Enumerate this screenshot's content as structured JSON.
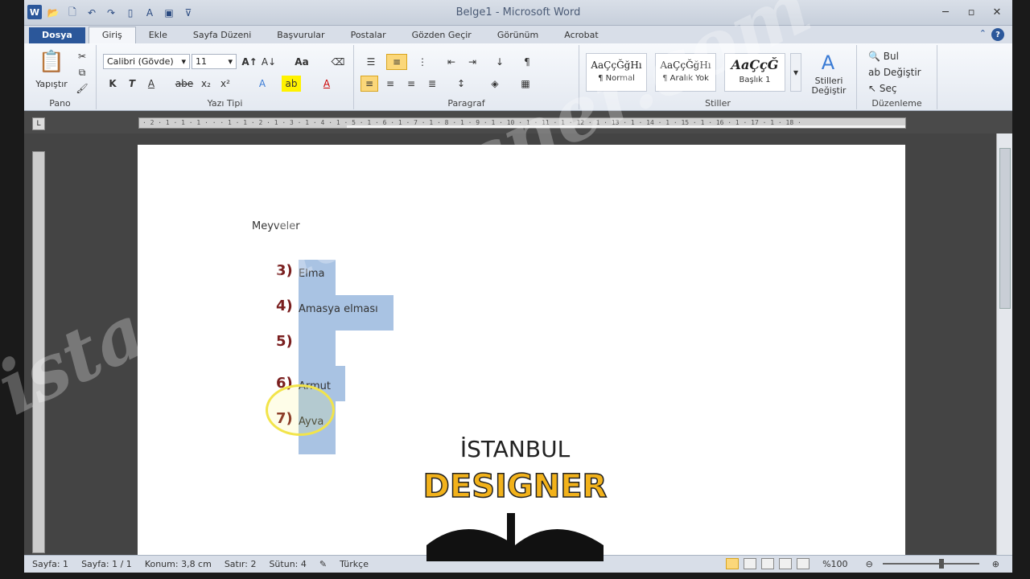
{
  "window": {
    "title": "Belge1 - Microsoft Word"
  },
  "tabs": [
    {
      "label": "Dosya"
    },
    {
      "label": "Giriş"
    },
    {
      "label": "Ekle"
    },
    {
      "label": "Sayfa Düzeni"
    },
    {
      "label": "Başvurular"
    },
    {
      "label": "Postalar"
    },
    {
      "label": "Gözden Geçir"
    },
    {
      "label": "Görünüm"
    },
    {
      "label": "Acrobat"
    }
  ],
  "ribbon": {
    "pano": {
      "label": "Pano",
      "paste": "Yapıştır"
    },
    "font": {
      "label": "Yazı Tipi",
      "family": "Calibri (Gövde)",
      "size": "11",
      "bold": "K",
      "italic": "T",
      "underline": "A",
      "strike": "abe",
      "sub": "x₂",
      "sup": "x²",
      "case": "Aa"
    },
    "paragraph": {
      "label": "Paragraf"
    },
    "styles": {
      "label": "Stiller",
      "items": [
        {
          "preview": "AaÇçĞğHı",
          "name": "¶ Normal"
        },
        {
          "preview": "AaÇçĞğHı",
          "name": "¶ Aralık Yok"
        },
        {
          "preview": "AaÇçĞ",
          "name": "Başlık 1"
        }
      ],
      "change": "Stilleri Değiştir"
    },
    "editing": {
      "label": "Düzenleme",
      "find": "Bul",
      "replace": "Değiştir",
      "select": "Seç"
    }
  },
  "ruler": {
    "text": "· 2 · 1 · 1 · 1 · · · 1 · 1 · 2 · 1 · 3 · 1 · 4 · 1 · 5 · 1 · 6 · 1 · 7 · 1 · 8 · 1 · 9 · 1 · 10 · 1 · 11 · 1 · 12 · 1 · 13 · 1 · 14 · 1 · 15 · 1 · 16 · 1 · 17 · 1 · 18 ·"
  },
  "document": {
    "heading": "Meyveler",
    "list": [
      {
        "num": "3)",
        "text": "Elma"
      },
      {
        "num": "4)",
        "text": "Amasya elması"
      },
      {
        "num": "5)",
        "text": ""
      },
      {
        "num": "6)",
        "text": "Armut"
      },
      {
        "num": "7)",
        "text": "Ayva"
      }
    ]
  },
  "status": {
    "page": "Sayfa: 1",
    "pages": "Sayfa: 1 / 1",
    "position": "Konum: 3,8 cm",
    "line": "Satır: 2",
    "column": "Sütun: 4",
    "language": "Türkçe",
    "zoom": "%100"
  },
  "watermark": "istanbuldesigner.com",
  "logo": {
    "top": "İSTANBUL",
    "bottom": "DESIGNER"
  }
}
